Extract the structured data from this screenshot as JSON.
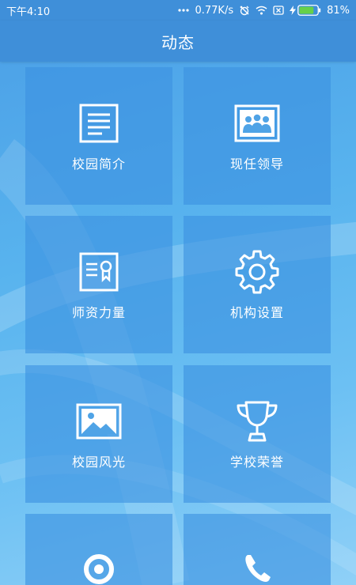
{
  "status_bar": {
    "time": "下午4:10",
    "network_speed": "0.77K/s",
    "battery_percent": "81%",
    "battery_level": 0.81,
    "icons": [
      "more-dots-icon",
      "alarm-off-icon",
      "wifi-icon",
      "sim-blocked-icon",
      "charging-bolt-icon",
      "battery-icon"
    ]
  },
  "header": {
    "title": "动态"
  },
  "tiles": [
    {
      "label": "校园简介",
      "icon": "document-icon"
    },
    {
      "label": "现任领导",
      "icon": "leaders-photo-icon"
    },
    {
      "label": "师资力量",
      "icon": "certificate-icon"
    },
    {
      "label": "机构设置",
      "icon": "gear-icon"
    },
    {
      "label": "校园风光",
      "icon": "landscape-image-icon"
    },
    {
      "label": "学校荣誉",
      "icon": "trophy-icon"
    },
    {
      "label": "",
      "icon": "location-pin-icon"
    },
    {
      "label": "",
      "icon": "phone-icon"
    }
  ],
  "colors": {
    "header_bg": "#3f8fd9",
    "tile_bg": "#3c91e1",
    "background_top": "#4a9ee6",
    "background_bottom": "#8fd0f7",
    "text": "#ffffff"
  }
}
